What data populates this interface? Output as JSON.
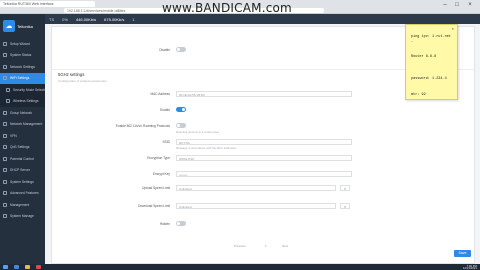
{
  "browser": {
    "tab_title": "Teltonika RUT360 Web Interface",
    "url": "192.168.1.1/#/services/mobile-utilities",
    "recorder_watermark": "www.BANDICAM.com"
  },
  "sidebar": {
    "logo_text": "Teltonika",
    "items": [
      {
        "label": "Setup Wizard",
        "active": false
      },
      {
        "label": "System Status",
        "active": false
      },
      {
        "label": "Network Settings",
        "active": false
      },
      {
        "label": "WiFi Settings",
        "active": true
      },
      {
        "label": "Security Mode Selection",
        "active": false,
        "sub": true
      },
      {
        "label": "Wireless Settings",
        "active": false,
        "sub": true
      },
      {
        "label": "Group Network",
        "active": false
      },
      {
        "label": "Network Management",
        "active": false
      },
      {
        "label": "VPN",
        "active": false
      },
      {
        "label": "QoS Settings",
        "active": false
      },
      {
        "label": "Parental Control",
        "active": false
      },
      {
        "label": "DHCP Server",
        "active": false
      },
      {
        "label": "System Settings",
        "active": false
      },
      {
        "label": "Advanced Features",
        "active": false
      },
      {
        "label": "Management",
        "active": false
      },
      {
        "label": "System Manage",
        "active": false
      }
    ]
  },
  "topbar": {
    "items": [
      "TS",
      "0%",
      "446.00Kb/s",
      "675.00Kb/s",
      "1"
    ]
  },
  "form": {
    "top_label": "Disable",
    "section_title": "5GHz settings",
    "section_subtitle": "Configuration of wireless parameters",
    "fields": [
      {
        "label": "MAC Address",
        "value": "00:1E:A0:55:1B:D0",
        "kind": "text"
      },
      {
        "label": "Enable",
        "kind": "toggle",
        "on": true
      },
      {
        "label": "Enable 802.11k/v/r Roaming Protocols",
        "kind": "toggle",
        "on": false,
        "hint": "Roaming protocol in a certain area"
      },
      {
        "label": "SSID",
        "value": "RUT-5G",
        "kind": "text",
        "hint": "Message in accordance with the MAC addresses"
      },
      {
        "label": "Encryption Type",
        "value": "WPA2-PSK",
        "kind": "text"
      },
      {
        "label": "Encrypt Key",
        "value": "••••••••",
        "kind": "text"
      },
      {
        "label": "Upload Speed Limit",
        "value": "Unlimited",
        "kind": "select"
      },
      {
        "label": "Download Speed Limit",
        "value": "Unlimited",
        "kind": "select"
      },
      {
        "label": "Hidden",
        "kind": "toggle",
        "on": false
      }
    ]
  },
  "pagination": {
    "prev": "Previous",
    "page": "1",
    "next": "Next"
  },
  "save_label": "Save",
  "sticky_note": {
    "close_glyph": "×",
    "lines": [
      "ping ipv: 1.rut.net",
      "-",
      "Router 8.8.8",
      "password: 1.234.4",
      "mtr: 92"
    ]
  },
  "taskbar": {
    "clock_time": "7:00 PM",
    "clock_date": "12/21/2021"
  }
}
